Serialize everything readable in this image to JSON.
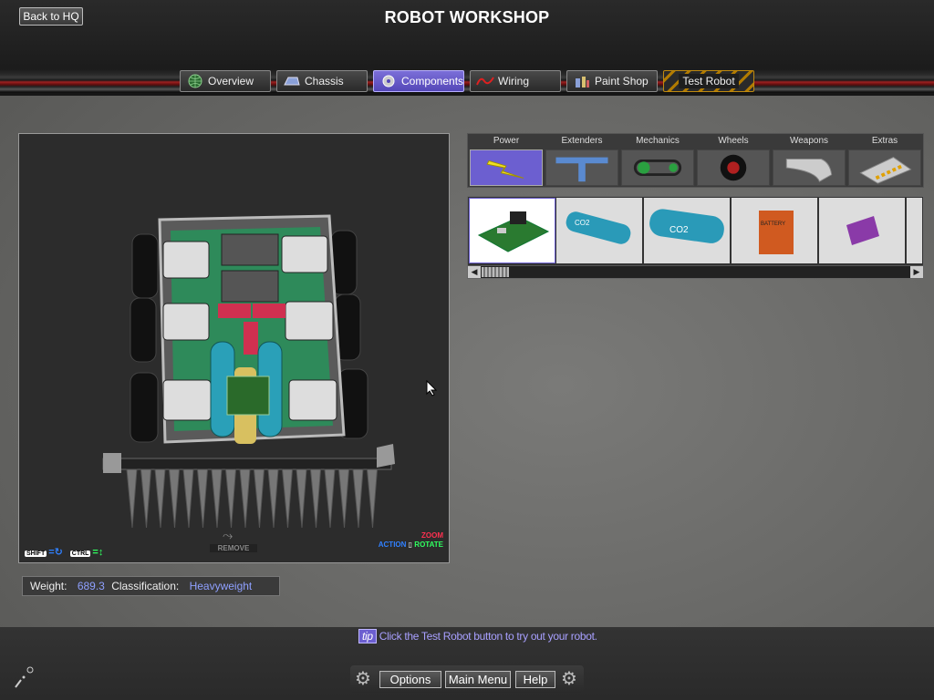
{
  "header": {
    "back_label": "Back to HQ",
    "title": "ROBOT WORKSHOP",
    "tabs": [
      {
        "label": "Overview",
        "icon": "globe-icon"
      },
      {
        "label": "Chassis",
        "icon": "chassis-icon"
      },
      {
        "label": "Components",
        "icon": "gear-icon",
        "active": true
      },
      {
        "label": "Wiring",
        "icon": "wire-icon"
      },
      {
        "label": "Paint Shop",
        "icon": "paint-icon"
      },
      {
        "label": "Test Robot"
      }
    ]
  },
  "robot_view": {
    "shift_key": "SHIFT",
    "ctrl_key": "CTRL",
    "zoom_label": "ZOOM",
    "action_label": "ACTION",
    "rotate_label": "ROTATE",
    "remove_label": "REMOVE",
    "component_labels": [
      "CO2",
      "CO2"
    ]
  },
  "weight": {
    "weight_label": "Weight:",
    "weight_value": "689.3",
    "class_label": "Classification:",
    "class_value": "Heavyweight"
  },
  "categories": [
    {
      "label": "Power",
      "icon": "lightning-icon",
      "active": true
    },
    {
      "label": "Extenders",
      "icon": "t-bar-icon"
    },
    {
      "label": "Mechanics",
      "icon": "chain-drive-icon"
    },
    {
      "label": "Wheels",
      "icon": "wheel-icon"
    },
    {
      "label": "Weapons",
      "icon": "scoop-icon"
    },
    {
      "label": "Extras",
      "icon": "hazard-plate-icon"
    }
  ],
  "parts": [
    {
      "label": "",
      "icon": "circuit-board-icon",
      "selected": true
    },
    {
      "label": "CO2",
      "icon": "co2-tank-icon"
    },
    {
      "label": "CO2",
      "icon": "co2-tank-large-icon"
    },
    {
      "label": "BATTERY",
      "icon": "battery-orange-icon"
    },
    {
      "label": "",
      "icon": "battery-purple-icon"
    }
  ],
  "footer": {
    "tip_badge": "tip",
    "tip_text": "Click the Test Robot button to try out your robot.",
    "options_label": "Options",
    "main_menu_label": "Main Menu",
    "help_label": "Help"
  },
  "colors": {
    "accent": "#6c5fd0",
    "value_text": "#8fa0ff",
    "zoom": "#ff3050",
    "action": "#3080ff",
    "rotate": "#30ff60"
  }
}
